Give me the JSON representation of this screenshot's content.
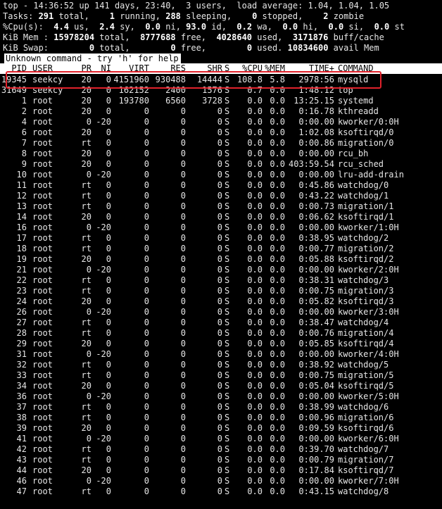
{
  "summary": {
    "top_line": {
      "time": "14:36:52",
      "uptime": "141 days, 23:40",
      "users": "3",
      "load1": "1.04",
      "load5": "1.04",
      "load15": "1.05"
    },
    "tasks": {
      "total": "291",
      "running": "1",
      "sleeping": "288",
      "stopped": "0",
      "zombie": "2"
    },
    "cpu": {
      "us": "4.4",
      "sy": "2.4",
      "ni": "0.0",
      "id": "93.0",
      "wa": "0.2",
      "hi": "0.0",
      "si": "0.0",
      "st": "0.0"
    },
    "mem": {
      "total": "15978204",
      "free": "8777688",
      "used": "4028640",
      "buff_cache": "3171876"
    },
    "swap": {
      "total": "0",
      "free": "0",
      "used": "0",
      "avail_mem": "10834600"
    }
  },
  "message": "Unknown command - try 'h' for help",
  "columns": [
    "PID",
    "USER",
    "PR",
    "NI",
    "VIRT",
    "RES",
    "SHR",
    "S",
    "%CPU",
    "%MEM",
    "TIME+",
    "COMMAND"
  ],
  "processes": [
    {
      "pid": "19345",
      "user": "seekcy",
      "pr": "20",
      "ni": "0",
      "virt": "4151960",
      "res": "930488",
      "shr": "14444",
      "s": "S",
      "cpu": "108.8",
      "mem": "5.8",
      "time": "2978:56",
      "cmd": "mysqld"
    },
    {
      "pid": "31649",
      "user": "seekcy",
      "pr": "20",
      "ni": "0",
      "virt": "162152",
      "res": "2400",
      "shr": "1576",
      "s": "S",
      "cpu": "0.7",
      "mem": "0.0",
      "time": "1:48.12",
      "cmd": "top"
    },
    {
      "pid": "1",
      "user": "root",
      "pr": "20",
      "ni": "0",
      "virt": "193780",
      "res": "6560",
      "shr": "3728",
      "s": "S",
      "cpu": "0.0",
      "mem": "0.0",
      "time": "13:25.15",
      "cmd": "systemd"
    },
    {
      "pid": "2",
      "user": "root",
      "pr": "20",
      "ni": "0",
      "virt": "0",
      "res": "0",
      "shr": "0",
      "s": "S",
      "cpu": "0.0",
      "mem": "0.0",
      "time": "0:16.78",
      "cmd": "kthreadd"
    },
    {
      "pid": "4",
      "user": "root",
      "pr": "0",
      "ni": "-20",
      "virt": "0",
      "res": "0",
      "shr": "0",
      "s": "S",
      "cpu": "0.0",
      "mem": "0.0",
      "time": "0:00.00",
      "cmd": "kworker/0:0H"
    },
    {
      "pid": "6",
      "user": "root",
      "pr": "20",
      "ni": "0",
      "virt": "0",
      "res": "0",
      "shr": "0",
      "s": "S",
      "cpu": "0.0",
      "mem": "0.0",
      "time": "1:02.08",
      "cmd": "ksoftirqd/0"
    },
    {
      "pid": "7",
      "user": "root",
      "pr": "rt",
      "ni": "0",
      "virt": "0",
      "res": "0",
      "shr": "0",
      "s": "S",
      "cpu": "0.0",
      "mem": "0.0",
      "time": "0:00.86",
      "cmd": "migration/0"
    },
    {
      "pid": "8",
      "user": "root",
      "pr": "20",
      "ni": "0",
      "virt": "0",
      "res": "0",
      "shr": "0",
      "s": "S",
      "cpu": "0.0",
      "mem": "0.0",
      "time": "0:00.00",
      "cmd": "rcu_bh"
    },
    {
      "pid": "9",
      "user": "root",
      "pr": "20",
      "ni": "0",
      "virt": "0",
      "res": "0",
      "shr": "0",
      "s": "S",
      "cpu": "0.0",
      "mem": "0.0",
      "time": "403:59.54",
      "cmd": "rcu_sched"
    },
    {
      "pid": "10",
      "user": "root",
      "pr": "0",
      "ni": "-20",
      "virt": "0",
      "res": "0",
      "shr": "0",
      "s": "S",
      "cpu": "0.0",
      "mem": "0.0",
      "time": "0:00.00",
      "cmd": "lru-add-drain"
    },
    {
      "pid": "11",
      "user": "root",
      "pr": "rt",
      "ni": "0",
      "virt": "0",
      "res": "0",
      "shr": "0",
      "s": "S",
      "cpu": "0.0",
      "mem": "0.0",
      "time": "0:45.86",
      "cmd": "watchdog/0"
    },
    {
      "pid": "12",
      "user": "root",
      "pr": "rt",
      "ni": "0",
      "virt": "0",
      "res": "0",
      "shr": "0",
      "s": "S",
      "cpu": "0.0",
      "mem": "0.0",
      "time": "0:43.22",
      "cmd": "watchdog/1"
    },
    {
      "pid": "13",
      "user": "root",
      "pr": "rt",
      "ni": "0",
      "virt": "0",
      "res": "0",
      "shr": "0",
      "s": "S",
      "cpu": "0.0",
      "mem": "0.0",
      "time": "0:00.73",
      "cmd": "migration/1"
    },
    {
      "pid": "14",
      "user": "root",
      "pr": "20",
      "ni": "0",
      "virt": "0",
      "res": "0",
      "shr": "0",
      "s": "S",
      "cpu": "0.0",
      "mem": "0.0",
      "time": "0:06.62",
      "cmd": "ksoftirqd/1"
    },
    {
      "pid": "16",
      "user": "root",
      "pr": "0",
      "ni": "-20",
      "virt": "0",
      "res": "0",
      "shr": "0",
      "s": "S",
      "cpu": "0.0",
      "mem": "0.0",
      "time": "0:00.00",
      "cmd": "kworker/1:0H"
    },
    {
      "pid": "17",
      "user": "root",
      "pr": "rt",
      "ni": "0",
      "virt": "0",
      "res": "0",
      "shr": "0",
      "s": "S",
      "cpu": "0.0",
      "mem": "0.0",
      "time": "0:38.95",
      "cmd": "watchdog/2"
    },
    {
      "pid": "18",
      "user": "root",
      "pr": "rt",
      "ni": "0",
      "virt": "0",
      "res": "0",
      "shr": "0",
      "s": "S",
      "cpu": "0.0",
      "mem": "0.0",
      "time": "0:00.77",
      "cmd": "migration/2"
    },
    {
      "pid": "19",
      "user": "root",
      "pr": "20",
      "ni": "0",
      "virt": "0",
      "res": "0",
      "shr": "0",
      "s": "S",
      "cpu": "0.0",
      "mem": "0.0",
      "time": "0:05.88",
      "cmd": "ksoftirqd/2"
    },
    {
      "pid": "21",
      "user": "root",
      "pr": "0",
      "ni": "-20",
      "virt": "0",
      "res": "0",
      "shr": "0",
      "s": "S",
      "cpu": "0.0",
      "mem": "0.0",
      "time": "0:00.00",
      "cmd": "kworker/2:0H"
    },
    {
      "pid": "22",
      "user": "root",
      "pr": "rt",
      "ni": "0",
      "virt": "0",
      "res": "0",
      "shr": "0",
      "s": "S",
      "cpu": "0.0",
      "mem": "0.0",
      "time": "0:38.31",
      "cmd": "watchdog/3"
    },
    {
      "pid": "23",
      "user": "root",
      "pr": "rt",
      "ni": "0",
      "virt": "0",
      "res": "0",
      "shr": "0",
      "s": "S",
      "cpu": "0.0",
      "mem": "0.0",
      "time": "0:00.75",
      "cmd": "migration/3"
    },
    {
      "pid": "24",
      "user": "root",
      "pr": "20",
      "ni": "0",
      "virt": "0",
      "res": "0",
      "shr": "0",
      "s": "S",
      "cpu": "0.0",
      "mem": "0.0",
      "time": "0:05.82",
      "cmd": "ksoftirqd/3"
    },
    {
      "pid": "26",
      "user": "root",
      "pr": "0",
      "ni": "-20",
      "virt": "0",
      "res": "0",
      "shr": "0",
      "s": "S",
      "cpu": "0.0",
      "mem": "0.0",
      "time": "0:00.00",
      "cmd": "kworker/3:0H"
    },
    {
      "pid": "27",
      "user": "root",
      "pr": "rt",
      "ni": "0",
      "virt": "0",
      "res": "0",
      "shr": "0",
      "s": "S",
      "cpu": "0.0",
      "mem": "0.0",
      "time": "0:38.47",
      "cmd": "watchdog/4"
    },
    {
      "pid": "28",
      "user": "root",
      "pr": "rt",
      "ni": "0",
      "virt": "0",
      "res": "0",
      "shr": "0",
      "s": "S",
      "cpu": "0.0",
      "mem": "0.0",
      "time": "0:00.76",
      "cmd": "migration/4"
    },
    {
      "pid": "29",
      "user": "root",
      "pr": "20",
      "ni": "0",
      "virt": "0",
      "res": "0",
      "shr": "0",
      "s": "S",
      "cpu": "0.0",
      "mem": "0.0",
      "time": "0:05.85",
      "cmd": "ksoftirqd/4"
    },
    {
      "pid": "31",
      "user": "root",
      "pr": "0",
      "ni": "-20",
      "virt": "0",
      "res": "0",
      "shr": "0",
      "s": "S",
      "cpu": "0.0",
      "mem": "0.0",
      "time": "0:00.00",
      "cmd": "kworker/4:0H"
    },
    {
      "pid": "32",
      "user": "root",
      "pr": "rt",
      "ni": "0",
      "virt": "0",
      "res": "0",
      "shr": "0",
      "s": "S",
      "cpu": "0.0",
      "mem": "0.0",
      "time": "0:38.92",
      "cmd": "watchdog/5"
    },
    {
      "pid": "33",
      "user": "root",
      "pr": "rt",
      "ni": "0",
      "virt": "0",
      "res": "0",
      "shr": "0",
      "s": "S",
      "cpu": "0.0",
      "mem": "0.0",
      "time": "0:00.75",
      "cmd": "migration/5"
    },
    {
      "pid": "34",
      "user": "root",
      "pr": "20",
      "ni": "0",
      "virt": "0",
      "res": "0",
      "shr": "0",
      "s": "S",
      "cpu": "0.0",
      "mem": "0.0",
      "time": "0:05.04",
      "cmd": "ksoftirqd/5"
    },
    {
      "pid": "36",
      "user": "root",
      "pr": "0",
      "ni": "-20",
      "virt": "0",
      "res": "0",
      "shr": "0",
      "s": "S",
      "cpu": "0.0",
      "mem": "0.0",
      "time": "0:00.00",
      "cmd": "kworker/5:0H"
    },
    {
      "pid": "37",
      "user": "root",
      "pr": "rt",
      "ni": "0",
      "virt": "0",
      "res": "0",
      "shr": "0",
      "s": "S",
      "cpu": "0.0",
      "mem": "0.0",
      "time": "0:38.99",
      "cmd": "watchdog/6"
    },
    {
      "pid": "38",
      "user": "root",
      "pr": "rt",
      "ni": "0",
      "virt": "0",
      "res": "0",
      "shr": "0",
      "s": "S",
      "cpu": "0.0",
      "mem": "0.0",
      "time": "0:00.96",
      "cmd": "migration/6"
    },
    {
      "pid": "39",
      "user": "root",
      "pr": "20",
      "ni": "0",
      "virt": "0",
      "res": "0",
      "shr": "0",
      "s": "S",
      "cpu": "0.0",
      "mem": "0.0",
      "time": "0:09.59",
      "cmd": "ksoftirqd/6"
    },
    {
      "pid": "41",
      "user": "root",
      "pr": "0",
      "ni": "-20",
      "virt": "0",
      "res": "0",
      "shr": "0",
      "s": "S",
      "cpu": "0.0",
      "mem": "0.0",
      "time": "0:00.00",
      "cmd": "kworker/6:0H"
    },
    {
      "pid": "42",
      "user": "root",
      "pr": "rt",
      "ni": "0",
      "virt": "0",
      "res": "0",
      "shr": "0",
      "s": "S",
      "cpu": "0.0",
      "mem": "0.0",
      "time": "0:39.70",
      "cmd": "watchdog/7"
    },
    {
      "pid": "43",
      "user": "root",
      "pr": "rt",
      "ni": "0",
      "virt": "0",
      "res": "0",
      "shr": "0",
      "s": "S",
      "cpu": "0.0",
      "mem": "0.0",
      "time": "0:00.79",
      "cmd": "migration/7"
    },
    {
      "pid": "44",
      "user": "root",
      "pr": "20",
      "ni": "0",
      "virt": "0",
      "res": "0",
      "shr": "0",
      "s": "S",
      "cpu": "0.0",
      "mem": "0.0",
      "time": "0:17.84",
      "cmd": "ksoftirqd/7"
    },
    {
      "pid": "46",
      "user": "root",
      "pr": "0",
      "ni": "-20",
      "virt": "0",
      "res": "0",
      "shr": "0",
      "s": "S",
      "cpu": "0.0",
      "mem": "0.0",
      "time": "0:00.00",
      "cmd": "kworker/7:0H"
    },
    {
      "pid": "47",
      "user": "root",
      "pr": "rt",
      "ni": "0",
      "virt": "0",
      "res": "0",
      "shr": "0",
      "s": "S",
      "cpu": "0.0",
      "mem": "0.0",
      "time": "0:43.15",
      "cmd": "watchdog/8"
    }
  ],
  "colors": {
    "background": "#000000",
    "text": "#e6e6e6",
    "highlight": "#ffffff",
    "annotation_box": "#e0222b"
  }
}
